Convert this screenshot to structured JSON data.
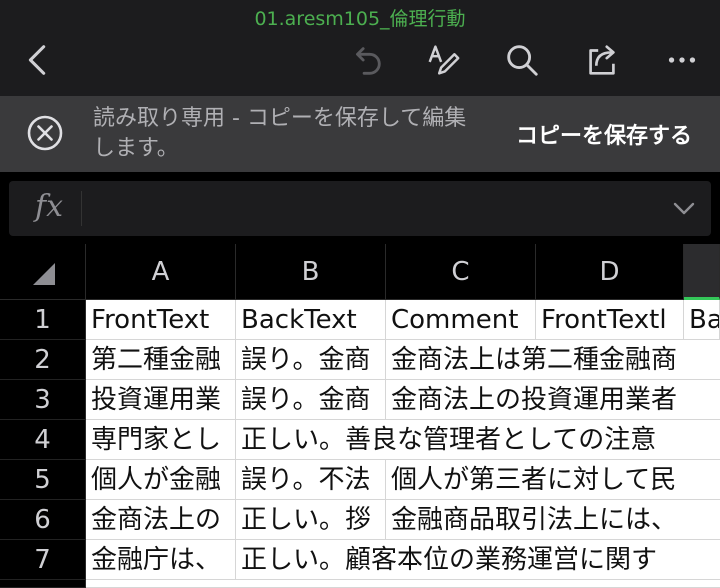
{
  "titlebar": {
    "filename": "01.aresm105_倫理行動",
    "icons": [
      "chevron-left-icon",
      "undo-icon",
      "text-edit-icon",
      "search-icon",
      "share-icon",
      "more-icon"
    ]
  },
  "banner": {
    "message": "読み取り専用 - コピーを保存して編集します。",
    "action": "コピーを保存する"
  },
  "formula_bar": {
    "label": "fx",
    "value": ""
  },
  "sheet": {
    "columns": [
      "A",
      "B",
      "C",
      "D",
      ""
    ],
    "rows": [
      "1",
      "2",
      "3",
      "4",
      "5",
      "6",
      "7"
    ],
    "cells": [
      [
        "FrontText",
        "BackText",
        "Comment",
        "FrontTextl",
        "Ba"
      ],
      [
        "第二種金融",
        "誤り。金商",
        "金商法上は第二種金融商",
        "",
        ""
      ],
      [
        "投資運用業",
        "誤り。金商",
        "金商法上の投資運用業者",
        "",
        ""
      ],
      [
        "専門家とし",
        "正しい。善良な管理者としての注意",
        "",
        "",
        ""
      ],
      [
        "個人が金融",
        "誤り。不法",
        "個人が第三者に対して民",
        "",
        ""
      ],
      [
        "金商法上の",
        "正しい。拶",
        "金融商品取引法上には、",
        "",
        ""
      ],
      [
        "金融庁は、",
        "正しい。顧客本位の業務運営に関す",
        "",
        "",
        ""
      ]
    ]
  },
  "colors": {
    "accent": "#34c759",
    "filename": "#4caf50"
  }
}
